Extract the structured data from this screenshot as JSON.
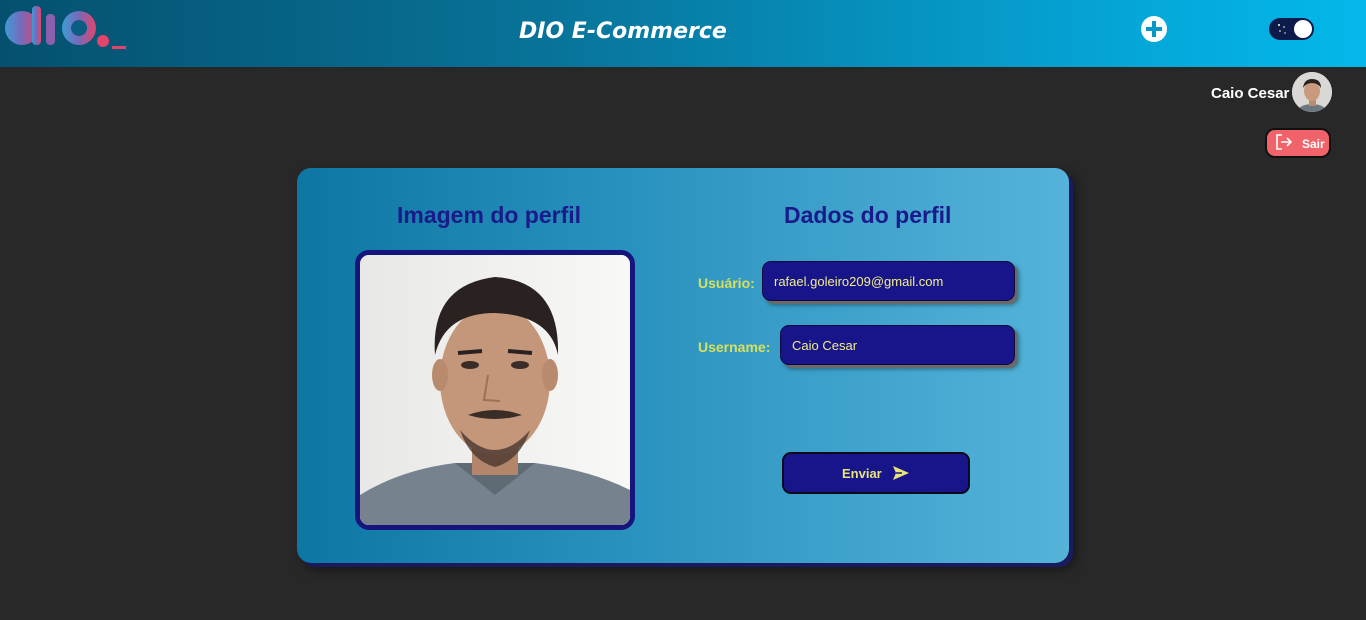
{
  "header": {
    "title": "DIO E-Commerce",
    "logo_icon": "dio-logo-icon",
    "add_icon": "plus-circle-icon",
    "theme_toggle": {
      "icon": "moon-stars-icon",
      "state": "on"
    }
  },
  "user": {
    "name": "Caio Cesar",
    "avatar_icon": "user-avatar",
    "logout_label": "Sair",
    "logout_icon": "sign-out-icon"
  },
  "profile": {
    "image_heading": "Imagem do perfil",
    "data_heading": "Dados do perfil",
    "user_label": "Usuário:",
    "user_value": "rafael.goleiro209@gmail.com",
    "username_label": "Username:",
    "username_value": "Caio Cesar",
    "submit_label": "Enviar",
    "submit_icon": "send-arrow-icon"
  },
  "colors": {
    "background": "#282828",
    "heading": "#1a1a8a",
    "label": "#d7e05a",
    "input_bg": "#18158a",
    "input_text": "#f3ef8a",
    "logout_bg": "#f0636b"
  }
}
